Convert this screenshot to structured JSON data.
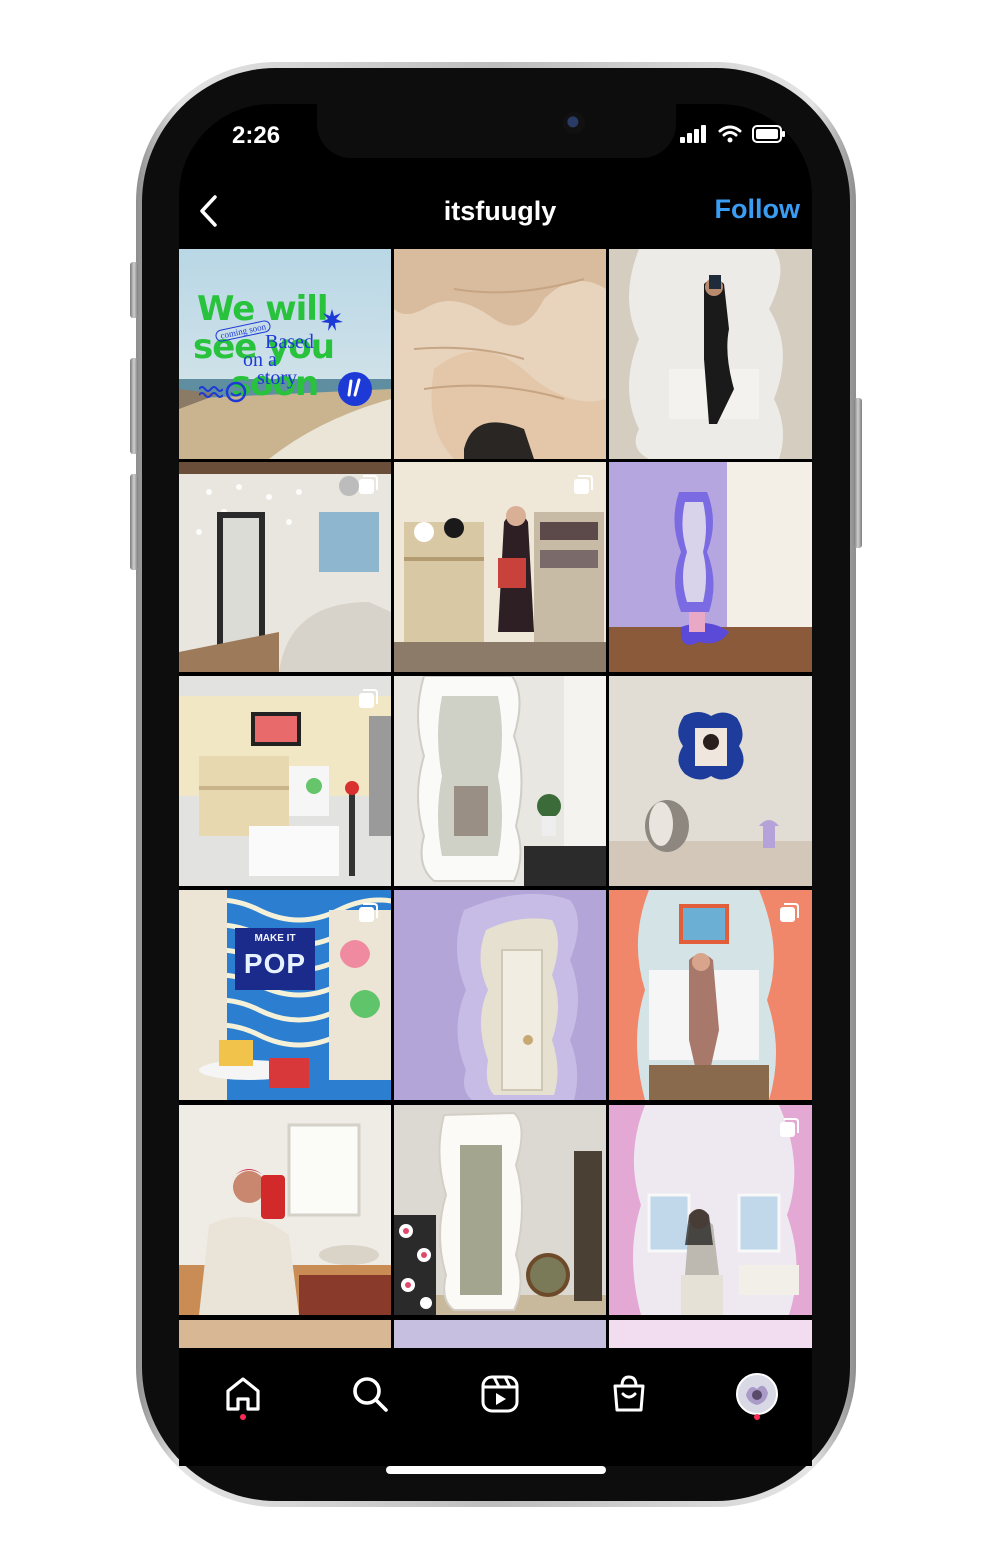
{
  "status_bar": {
    "time": "2:26"
  },
  "header": {
    "title": "itsfuugly",
    "follow_label": "Follow",
    "follow_color": "#3a9cf2"
  },
  "first_post": {
    "headline_line1": "We will",
    "headline_line2": "see you",
    "headline_line3": "soon",
    "overlay_line1": "Based",
    "overlay_line2": "on a",
    "overlay_line3": "story",
    "badge_text": "coming soon"
  },
  "pop_sign": {
    "line1": "MAKE IT",
    "line2": "POP"
  },
  "grid": {
    "tiles": [
      {
        "name": "post-coming-soon-beach",
        "multi": false
      },
      {
        "name": "post-wood-wavy-closeup",
        "multi": false
      },
      {
        "name": "post-wavy-mirror-selfie",
        "multi": false
      },
      {
        "name": "post-checkered-mirror-room",
        "multi": true
      },
      {
        "name": "post-store-shelves",
        "multi": true
      },
      {
        "name": "post-lavender-room-mirror",
        "multi": false
      },
      {
        "name": "post-popup-shop",
        "multi": true
      },
      {
        "name": "post-white-wavy-mirror",
        "multi": false
      },
      {
        "name": "post-blue-wavy-frame",
        "multi": false
      },
      {
        "name": "post-make-it-pop-wall",
        "multi": true
      },
      {
        "name": "post-lavender-wavy-mirror",
        "multi": false
      },
      {
        "name": "post-orange-wavy-mirror",
        "multi": true
      },
      {
        "name": "post-red-hair-selfie",
        "multi": false
      },
      {
        "name": "post-white-mirror-flowers",
        "multi": false
      },
      {
        "name": "post-pink-mirror-selfie",
        "multi": true
      }
    ]
  },
  "nav": {
    "items": [
      "home-icon",
      "search-icon",
      "reels-icon",
      "shop-icon",
      "profile-avatar"
    ],
    "dot_color": "#ff2a55"
  }
}
